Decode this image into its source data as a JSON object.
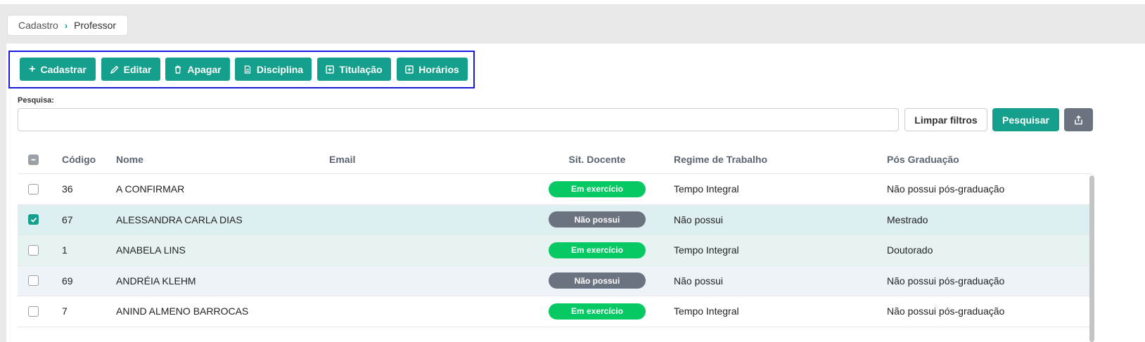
{
  "breadcrumb": {
    "root": "Cadastro",
    "current": "Professor"
  },
  "toolbar": {
    "cadastrar": "Cadastrar",
    "editar": "Editar",
    "apagar": "Apagar",
    "disciplina": "Disciplina",
    "titulacao": "Titulação",
    "horarios": "Horários"
  },
  "search": {
    "label": "Pesquisa:",
    "value": "",
    "placeholder": "",
    "clear": "Limpar filtros",
    "submit": "Pesquisar"
  },
  "table": {
    "headers": {
      "codigo": "Código",
      "nome": "Nome",
      "email": "Email",
      "sit": "Sit. Docente",
      "regime": "Regime de Trabalho",
      "pos": "Pós Graduação"
    },
    "rows": [
      {
        "codigo": "36",
        "nome": "A CONFIRMAR",
        "email": "",
        "sit": "Em exercício",
        "regime": "Tempo Integral",
        "pos": "Não possui pós-graduação"
      },
      {
        "codigo": "67",
        "nome": "ALESSANDRA CARLA DIAS",
        "email": "",
        "sit": "Não possui",
        "regime": "Não possui",
        "pos": "Mestrado"
      },
      {
        "codigo": "1",
        "nome": "ANABELA LINS",
        "email": "",
        "sit": "Em exercício",
        "regime": "Tempo Integral",
        "pos": "Doutorado"
      },
      {
        "codigo": "69",
        "nome": "ANDRÉIA KLEHM",
        "email": "",
        "sit": "Não possui",
        "regime": "Não possui",
        "pos": "Não possui pós-graduação"
      },
      {
        "codigo": "7",
        "nome": "ANIND ALMENO BARROCAS",
        "email": "",
        "sit": "Em exercício",
        "regime": "Tempo Integral",
        "pos": "Não possui pós-graduação"
      }
    ]
  },
  "colors": {
    "accent": "#14a08c",
    "status_active": "#06c964",
    "status_none": "#6b7280",
    "highlight_border": "#1a1adf"
  }
}
